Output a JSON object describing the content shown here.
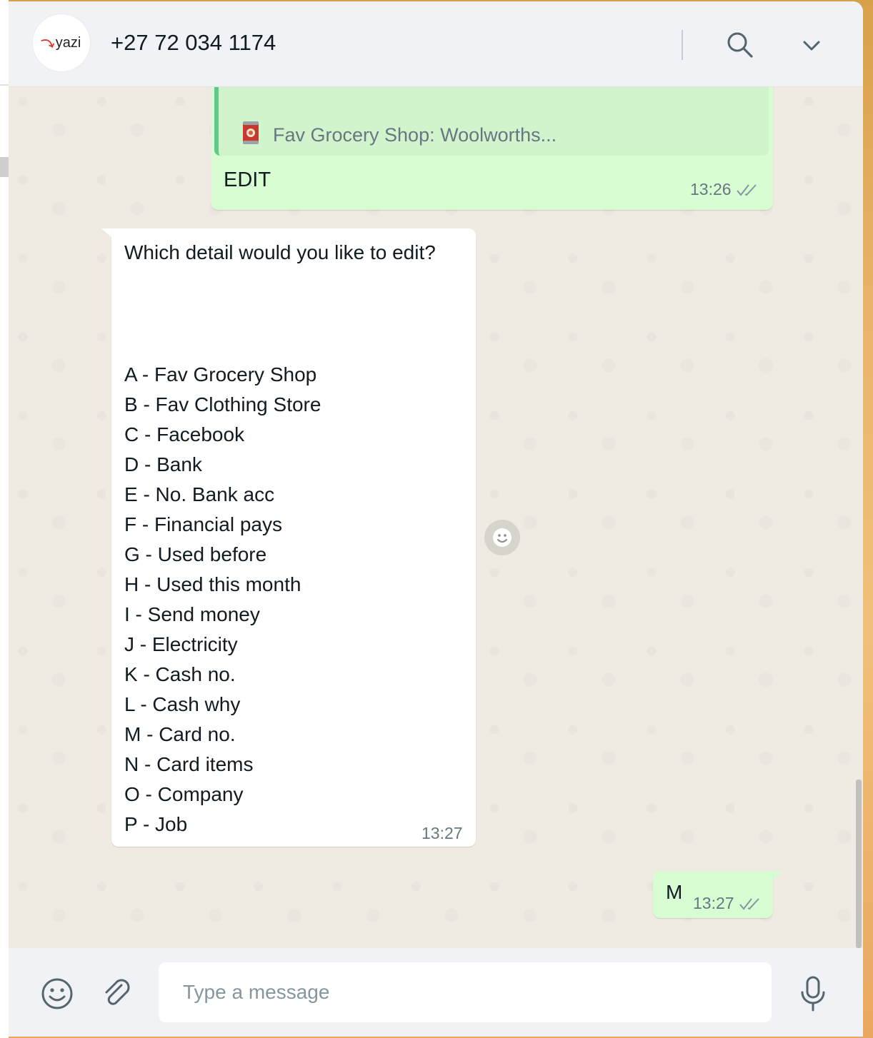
{
  "header": {
    "avatar_logo_text": "yazi",
    "contact_name": "+27 72 034 1174",
    "search_icon": "search-icon",
    "menu_icon": "chevron-down-icon"
  },
  "messages": {
    "edit_message": {
      "quote_icon": "tin-can-icon",
      "quote_text": "Fav Grocery Shop: Woolworths...",
      "text": "EDIT",
      "time": "13:26",
      "status": "read"
    },
    "bot_message": {
      "question": "Which detail would you like to edit?",
      "options": [
        "A - Fav Grocery Shop",
        "B - Fav Clothing Store",
        "C - Facebook",
        "D - Bank",
        "E - No. Bank acc",
        "F - Financial pays",
        "G - Used before",
        "H - Used this month",
        "I - Send money",
        "J - Electricity",
        "K - Cash no.",
        "L - Cash why",
        "M - Card no.",
        "N - Card items",
        "O - Company",
        "P - Job"
      ],
      "time": "13:27"
    },
    "reply_message": {
      "text": "M",
      "time": "13:27",
      "status": "read"
    }
  },
  "composer": {
    "placeholder": "Type a message",
    "value": "",
    "emoji_icon": "smiley-icon",
    "attach_icon": "paperclip-icon",
    "mic_icon": "microphone-icon"
  },
  "colors": {
    "outgoing_bubble": "#d9fdd3",
    "incoming_bubble": "#ffffff",
    "chat_background": "#efeae2",
    "quote_bar": "#5fca8c",
    "header_background": "#f0f2f5"
  }
}
